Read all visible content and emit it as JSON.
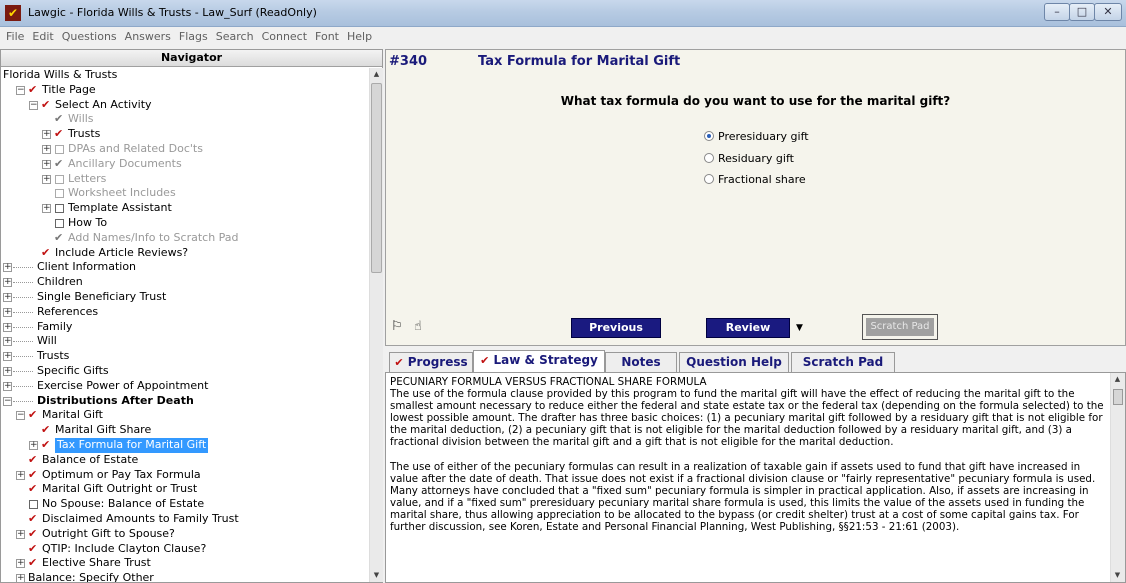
{
  "window": {
    "title": "Lawgic - Florida Wills & Trusts - Law_Surf (ReadOnly)",
    "controls": [
      "–",
      "□",
      "✕"
    ]
  },
  "menu": [
    "File",
    "Edit",
    "Questions",
    "Answers",
    "Flags",
    "Search",
    "Connect",
    "Font",
    "Help"
  ],
  "navigator": {
    "header": "Navigator",
    "items": [
      {
        "label": "Florida Wills & Trusts",
        "level": 0,
        "expander": "none",
        "marker": "none",
        "style": "normal"
      },
      {
        "label": "Title Page",
        "level": 1,
        "expander": "minus",
        "marker": "check",
        "style": "normal"
      },
      {
        "label": "Select An Activity",
        "level": 2,
        "expander": "minus",
        "marker": "check",
        "style": "normal"
      },
      {
        "label": "Wills",
        "level": 3,
        "expander": "none",
        "marker": "check-grey",
        "style": "grey"
      },
      {
        "label": "Trusts",
        "level": 3,
        "expander": "plus",
        "marker": "check",
        "style": "normal"
      },
      {
        "label": "DPAs and Related Doc'ts",
        "level": 3,
        "expander": "plus",
        "marker": "box-grey",
        "style": "grey"
      },
      {
        "label": "Ancillary Documents",
        "level": 3,
        "expander": "plus",
        "marker": "check-grey",
        "style": "grey"
      },
      {
        "label": "Letters",
        "level": 3,
        "expander": "plus",
        "marker": "box-grey",
        "style": "grey"
      },
      {
        "label": "Worksheet Includes",
        "level": 3,
        "expander": "none",
        "marker": "box-grey",
        "style": "grey"
      },
      {
        "label": "Template Assistant",
        "level": 3,
        "expander": "plus",
        "marker": "box",
        "style": "normal"
      },
      {
        "label": "How To",
        "level": 3,
        "expander": "none",
        "marker": "box",
        "style": "normal"
      },
      {
        "label": "Add Names/Info to Scratch Pad",
        "level": 3,
        "expander": "none",
        "marker": "check-grey",
        "style": "grey"
      },
      {
        "label": "Include Article Reviews?",
        "level": 2,
        "expander": "none",
        "marker": "check",
        "style": "normal"
      },
      {
        "label": "Client Information",
        "level": 0,
        "expander": "plus",
        "marker": "none",
        "style": "normal"
      },
      {
        "label": "Children",
        "level": 0,
        "expander": "plus",
        "marker": "none",
        "style": "normal"
      },
      {
        "label": "Single Beneficiary Trust",
        "level": 0,
        "expander": "plus",
        "marker": "none",
        "style": "normal"
      },
      {
        "label": "References",
        "level": 0,
        "expander": "plus",
        "marker": "none",
        "style": "normal"
      },
      {
        "label": "Family",
        "level": 0,
        "expander": "plus",
        "marker": "none",
        "style": "normal"
      },
      {
        "label": "Will",
        "level": 0,
        "expander": "plus",
        "marker": "none",
        "style": "normal"
      },
      {
        "label": "Trusts",
        "level": 0,
        "expander": "plus",
        "marker": "none",
        "style": "normal"
      },
      {
        "label": "Specific Gifts",
        "level": 0,
        "expander": "plus",
        "marker": "none",
        "style": "normal"
      },
      {
        "label": "Exercise Power of Appointment",
        "level": 0,
        "expander": "plus",
        "marker": "none",
        "style": "normal"
      },
      {
        "label": "Distributions After Death",
        "level": 0,
        "expander": "minus",
        "marker": "none",
        "style": "bold"
      },
      {
        "label": "Marital Gift",
        "level": 1,
        "expander": "minus",
        "marker": "check",
        "style": "normal"
      },
      {
        "label": "Marital Gift Share",
        "level": 2,
        "expander": "none",
        "marker": "check",
        "style": "normal"
      },
      {
        "label": "Tax Formula for Marital Gift",
        "level": 2,
        "expander": "plus",
        "marker": "check",
        "style": "selected"
      },
      {
        "label": "Balance of Estate",
        "level": 1,
        "expander": "none",
        "marker": "check",
        "style": "normal"
      },
      {
        "label": "Optimum or Pay Tax Formula",
        "level": 1,
        "expander": "plus",
        "marker": "check",
        "style": "normal"
      },
      {
        "label": "Marital Gift Outright or Trust",
        "level": 1,
        "expander": "none",
        "marker": "check",
        "style": "normal"
      },
      {
        "label": "No Spouse: Balance of Estate",
        "level": 1,
        "expander": "none",
        "marker": "box",
        "style": "normal"
      },
      {
        "label": "Disclaimed Amounts to Family Trust",
        "level": 1,
        "expander": "none",
        "marker": "check",
        "style": "normal"
      },
      {
        "label": "Outright Gift to Spouse?",
        "level": 1,
        "expander": "plus",
        "marker": "check",
        "style": "normal"
      },
      {
        "label": "QTIP: Include Clayton Clause?",
        "level": 1,
        "expander": "none",
        "marker": "check",
        "style": "normal"
      },
      {
        "label": "Elective Share Trust",
        "level": 1,
        "expander": "plus",
        "marker": "check",
        "style": "normal"
      },
      {
        "label": "Balance: Specify Other",
        "level": 1,
        "expander": "plus",
        "marker": "none",
        "style": "normal"
      }
    ]
  },
  "question": {
    "number": "#340",
    "title": "Tax Formula for Marital Gift",
    "prompt": "What tax formula do you want to use for the marital gift?",
    "options": [
      {
        "label": "Preresiduary gift",
        "selected": true
      },
      {
        "label": "Residuary gift",
        "selected": false
      },
      {
        "label": "Fractional share",
        "selected": false
      }
    ],
    "buttons": {
      "previous": "Previous",
      "review": "Review",
      "scratch_pad": "Scratch Pad"
    },
    "icons": [
      "flag-icon",
      "hand-pointer-icon"
    ]
  },
  "tabs": [
    {
      "label": "Progress",
      "marked": true,
      "active": false
    },
    {
      "label": "Law & Strategy",
      "marked": true,
      "active": true
    },
    {
      "label": "Notes",
      "marked": false,
      "active": false
    },
    {
      "label": "Question Help",
      "marked": false,
      "active": false
    },
    {
      "label": "Scratch Pad",
      "marked": false,
      "active": false
    }
  ],
  "law_text": {
    "heading": "PECUNIARY FORMULA VERSUS FRACTIONAL SHARE FORMULA",
    "paragraph1": "The use of the formula clause provided by this program to fund the marital gift will have the effect of reducing the marital gift to the smallest amount necessary to reduce either the federal and state estate tax or the federal tax (depending on the formula selected) to the lowest possible amount.  The drafter has three basic choices: (1) a pecuniary marital gift followed by a residuary gift that is not eligible for the marital deduction, (2) a pecuniary gift that is not eligible for the marital deduction followed by a residuary marital gift, and (3) a fractional division between the marital gift and a gift that is not eligible for the marital deduction.",
    "paragraph2": "The use of either of the pecuniary formulas can result in a realization of taxable gain if assets used to fund that gift have increased in value after the date of death.  That issue does not exist if a fractional division clause or \"fairly representative\" pecuniary formula is used.  Many attorneys have concluded that a \"fixed sum\" pecuniary formula is simpler in practical application.  Also, if assets are increasing in value, and if a \"fixed sum\" preresiduary pecuniary marital share formula is used, this limits the value of the assets used in funding the marital share, thus allowing appreciation to be allocated to the bypass (or credit shelter) trust at a cost of some capital gains tax.  For further discussion, see Koren, Estate and Personal Financial Planning, West Publishing, §§21:53 - 21:61 (2003)."
  },
  "colors": {
    "accent_navy": "#1a1a80",
    "check_red": "#c01010",
    "selection_blue": "#3399ff"
  }
}
